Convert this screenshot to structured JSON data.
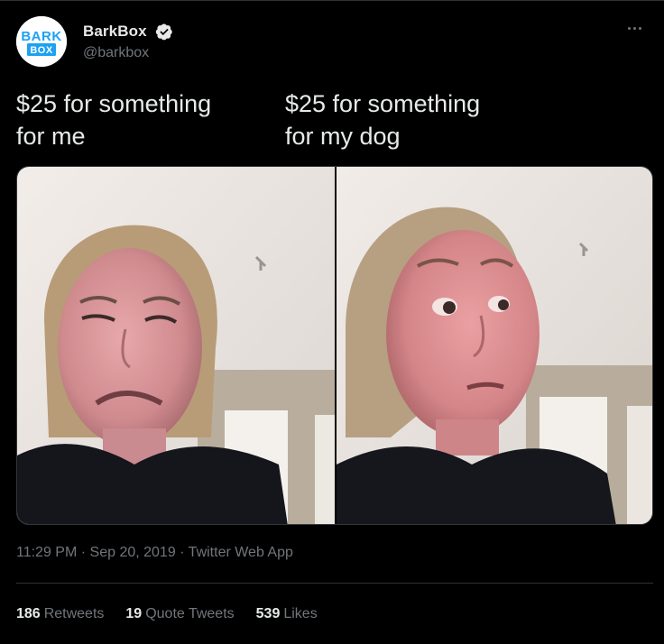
{
  "author": {
    "name": "BarkBox",
    "handle": "@barkbox",
    "avatar_text_top": "BARK",
    "avatar_text_bottom": "BOX",
    "brand_color": "#1da1f2"
  },
  "caption": {
    "left_line1": "$25 for something",
    "left_line2": "for me",
    "right_line1": "$25 for something",
    "right_line2": "for my dog"
  },
  "meta": {
    "time": "11:29 PM",
    "date": "Sep 20, 2019",
    "source": "Twitter Web App",
    "separator": "·"
  },
  "stats": {
    "retweets_count": "186",
    "retweets_label": "Retweets",
    "quotes_count": "19",
    "quotes_label": "Quote Tweets",
    "likes_count": "539",
    "likes_label": "Likes"
  },
  "icons": {
    "verified": "verified-badge-icon",
    "more": "more-options-icon"
  }
}
